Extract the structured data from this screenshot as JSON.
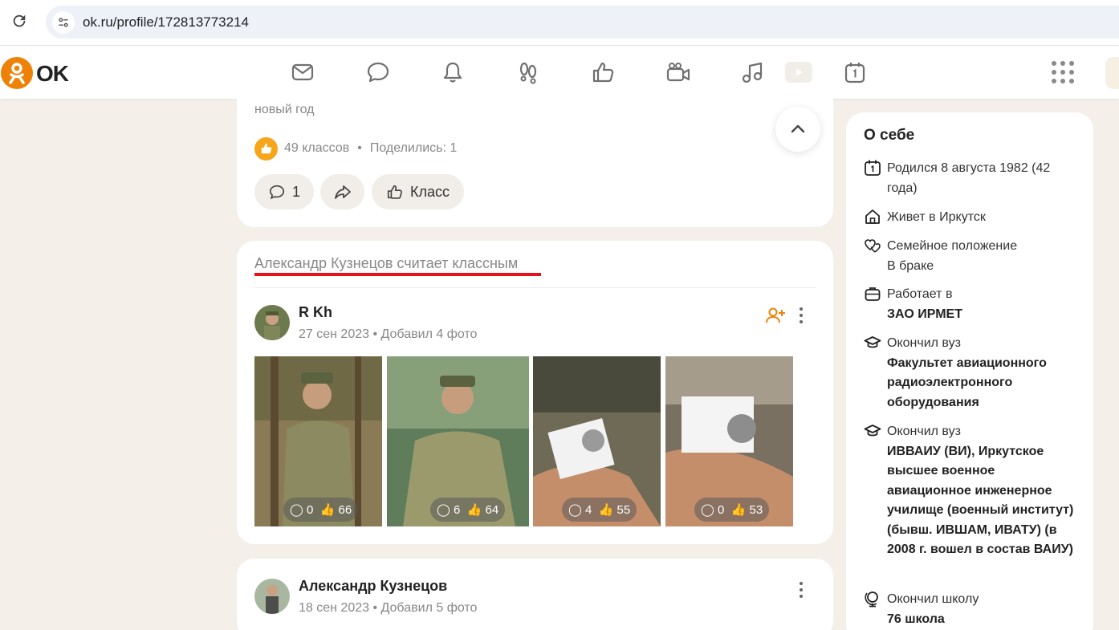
{
  "browser": {
    "url": "ok.ru/profile/172813773214"
  },
  "header": {
    "logo_text": "OK",
    "nav_icons": [
      "mail-icon",
      "chat-icon",
      "bell-icon",
      "guests-icon",
      "likes-icon",
      "video-camera-icon",
      "music-icon",
      "play-icon",
      "calendar-icon"
    ],
    "apps_icon": "apps-grid-icon",
    "brand_color": "#ee8208"
  },
  "post1": {
    "text_tail": "новый год",
    "likes": "49 классов",
    "shares": "Поделились: 1",
    "comment_count": "1",
    "class_label": "Класс"
  },
  "post2": {
    "topic": "Александр Кузнецов считает классным",
    "author": "R Kh",
    "date": "27 сен 2023",
    "action": "Добавил 4 фото",
    "photos": [
      {
        "comments": "0",
        "likes": "66"
      },
      {
        "comments": "6",
        "likes": "64"
      },
      {
        "comments": "4",
        "likes": "55"
      },
      {
        "comments": "0",
        "likes": "53"
      }
    ]
  },
  "post3": {
    "author": "Александр Кузнецов",
    "date": "18 сен 2023",
    "action": "Добавил 5 фото"
  },
  "about": {
    "title": "О себе",
    "born": "Родился 8 августа 1982 (42 года)",
    "lives": "Живет в Иркутск",
    "family_label": "Семейное положение",
    "family_value": "В браке",
    "work_label": "Работает в",
    "work_value": "ЗАО ИРМЕТ",
    "edu1_label": "Окончил вуз",
    "edu1_value": "Факультет авиационного радиоэлектронного оборудования",
    "edu2_label": "Окончил вуз",
    "edu2_value": "ИВВАИУ (ВИ), Иркутское высшее военное авиационное инженерное училище (военный институт) (бывш. ИВШАМ, ИВАТУ) (в 2008 г. вошел в состав ВАИУ)",
    "school_label": "Окончил школу",
    "school_value": "76 школа"
  },
  "colors": {
    "accent_red": "#e8101a",
    "add_friend_orange": "#ee8208",
    "like_yellow": "#f7a51a"
  }
}
